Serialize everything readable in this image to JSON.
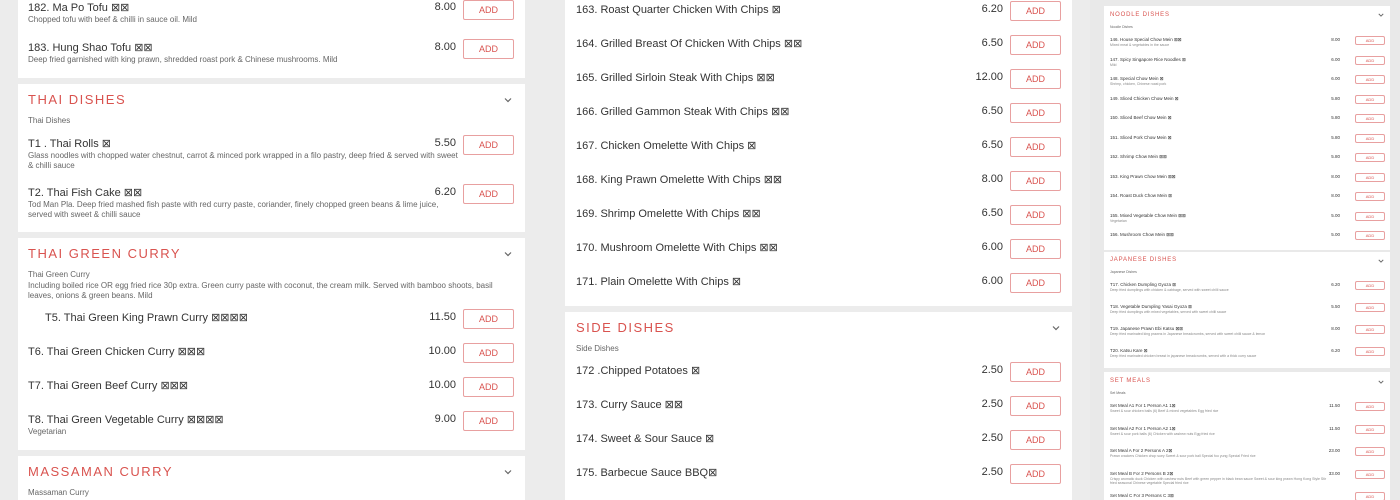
{
  "add_label": "ADD",
  "left": {
    "top_items": [
      {
        "name": "182. Ma Po Tofu ⊠⊠",
        "desc": "Chopped tofu with beef & chilli in sauce oil. Mild",
        "price": "8.00"
      },
      {
        "name": "183. Hung Shao Tofu ⊠⊠",
        "desc": "Deep fried garnished with king prawn, shredded roast pork & Chinese mushrooms. Mild",
        "price": "8.00"
      }
    ],
    "thai": {
      "title": "THAI DISHES",
      "sub": "Thai Dishes",
      "items": [
        {
          "name": "T1 . Thai Rolls ⊠",
          "desc": "Glass noodles with chopped water chestnut, carrot & minced pork wrapped in a filo pastry, deep fried & served with sweet & chilli sauce",
          "price": "5.50"
        },
        {
          "name": "T2. Thai Fish Cake ⊠⊠",
          "desc": "Tod Man Pla. Deep fried mashed fish paste with red curry paste, coriander, finely chopped green beans & lime juice, served with sweet & chilli sauce",
          "price": "6.20"
        }
      ]
    },
    "green": {
      "title": "THAI GREEN CURRY",
      "sub": "Thai Green Curry",
      "sub_desc": "Including boiled rice OR egg fried rice 30p extra. Green curry paste with coconut, the cream milk. Served with bamboo shoots, basil leaves, onions & green beans. Mild",
      "items": [
        {
          "name": "T5. Thai Green King Prawn Curry ⊠⊠⊠⊠",
          "desc": "",
          "price": "11.50"
        },
        {
          "name": "T6. Thai Green Chicken Curry ⊠⊠⊠",
          "desc": "",
          "price": "10.00"
        },
        {
          "name": "T7. Thai Green Beef Curry ⊠⊠⊠",
          "desc": "",
          "price": "10.00"
        },
        {
          "name": "T8. Thai Green Vegetable Curry ⊠⊠⊠⊠",
          "desc": "Vegetarian",
          "price": "9.00"
        }
      ]
    },
    "massaman": {
      "title": "MASSAMAN CURRY",
      "sub": "Massaman Curry"
    }
  },
  "middle": {
    "chips_items": [
      {
        "name": "163. Roast Quarter Chicken With Chips ⊠",
        "price": "6.20"
      },
      {
        "name": "164. Grilled Breast Of Chicken With Chips ⊠⊠",
        "price": "6.50"
      },
      {
        "name": "165. Grilled Sirloin Steak With Chips ⊠⊠",
        "price": "12.00"
      },
      {
        "name": "166. Grilled Gammon Steak With Chips ⊠⊠",
        "price": "6.50"
      },
      {
        "name": "167. Chicken Omelette With Chips ⊠",
        "price": "6.50"
      },
      {
        "name": "168. King Prawn Omelette With Chips ⊠⊠",
        "price": "8.00"
      },
      {
        "name": "169. Shrimp Omelette With Chips ⊠⊠",
        "price": "6.50"
      },
      {
        "name": "170. Mushroom Omelette With Chips ⊠⊠",
        "price": "6.00"
      },
      {
        "name": "171. Plain Omelette With Chips ⊠",
        "price": "6.00"
      }
    ],
    "side": {
      "title": "SIDE DISHES",
      "sub": "Side Dishes",
      "items": [
        {
          "name": "172 .Chipped Potatoes ⊠",
          "price": "2.50"
        },
        {
          "name": "173. Curry Sauce ⊠⊠",
          "price": "2.50"
        },
        {
          "name": "174. Sweet & Sour Sauce ⊠",
          "price": "2.50"
        },
        {
          "name": "175. Barbecue Sauce BBQ⊠",
          "price": "2.50"
        }
      ]
    }
  },
  "right": {
    "noodle": {
      "title": "NOODLE DISHES",
      "sub": "Noodle Dishes",
      "items": [
        {
          "name": "146. House Special Chow Mein ⊠⊠",
          "desc": "Mixed meat & vegetables in the sauce",
          "price": "8.00"
        },
        {
          "name": "147. Spicy Singapore Rice Noodles ⊠",
          "desc": "Mild",
          "price": "6.00"
        },
        {
          "name": "148. Special Chow Mein ⊠",
          "desc": "Shrimp, chicken, Chinese roast pork",
          "price": "6.00"
        },
        {
          "name": "149. Sliced Chicken Chow Mein ⊠",
          "desc": "",
          "price": "5.80"
        },
        {
          "name": "150. Sliced Beef Chow Mein ⊠",
          "desc": "",
          "price": "5.80"
        },
        {
          "name": "151. Sliced Pork Chow Mein ⊠",
          "desc": "",
          "price": "5.80"
        },
        {
          "name": "152. Shrimp Chow Mein ⊠⊠",
          "desc": "",
          "price": "5.80"
        },
        {
          "name": "153. King Prawn Chow Mein ⊠⊠",
          "desc": "",
          "price": "8.00"
        },
        {
          "name": "154. Roast Duck Chow Mein ⊠",
          "desc": "",
          "price": "8.00"
        },
        {
          "name": "155. Mixed Vegetable Chow Mein ⊠⊠",
          "desc": "Vegetarian",
          "price": "5.00"
        },
        {
          "name": "156. Mushroom Chow Mein ⊠⊠",
          "desc": "",
          "price": "5.00"
        }
      ]
    },
    "japanese": {
      "title": "JAPANESE DISHES",
      "sub": "Japanese Dishes",
      "items": [
        {
          "name": "T17. Chicken Dumpling Gyoza ⊠",
          "desc": "Deep fried dumplings with chicken & cabbage, served with sweet chilli sauce",
          "price": "6.20"
        },
        {
          "name": "T18. Vegetable Dumpling Yasai Gyoza ⊠",
          "desc": "Deep fried dumplings with mixed vegetables, served with sweet chilli sauce",
          "price": "5.50"
        },
        {
          "name": "T19. Japanese Prawn Ebi Katsu ⊠⊠",
          "desc": "Deep fried marinated king prawns in Japanese breadcrumbs, served with sweet chilli sauce & lemon",
          "price": "8.00"
        },
        {
          "name": "T20. Katsu Kare ⊠",
          "desc": "Deep fried marinated chicken breast in japanese breadcrumbs, served with a thick curry sauce",
          "price": "6.20"
        }
      ]
    },
    "set": {
      "title": "SET MEALS",
      "sub": "Set Meals",
      "items": [
        {
          "name": "Set Meal A1 For 1 Person A1 1⊠",
          "desc": "Sweet & sour chicken balls (6) Beef & mixed vegetables Egg fried rice",
          "price": "11.50"
        },
        {
          "name": "Set Meal A2 For 1 Person A2 1⊠",
          "desc": "Sweet & sour pork balls (6) Chicken with cashew nuts Egg fried rice",
          "price": "11.50"
        },
        {
          "name": "Set Meal A For 2 Persons A 2⊠",
          "desc": "Prawn crackers Chicken chop suey Sweet & sour pork ball Special foo yung Special Fried rice",
          "price": "23.00"
        },
        {
          "name": "Set Meal B For 2 Persons B 2⊠",
          "desc": "Crispy aromatic duck Chicken with cashew nuts Beef with green pepper in black bean sauce Sweet & sour king prawn Hong Kong Style Stir fried seasonal Chinese vegetable Special fried rice",
          "price": "33.00"
        },
        {
          "name": "Set Meal C For 3 Persons C 3⊠",
          "desc": "",
          "price": ""
        }
      ]
    }
  }
}
